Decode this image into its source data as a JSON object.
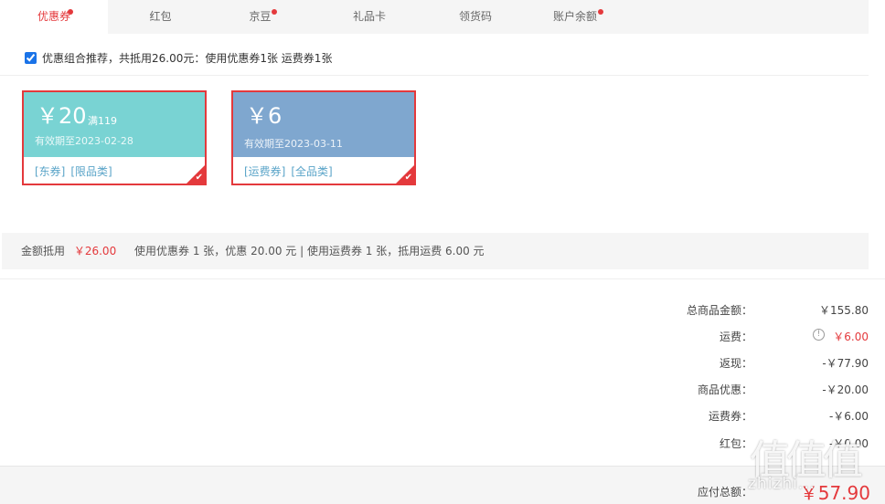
{
  "tabs": [
    {
      "label": "优惠券",
      "active": true,
      "dot": true
    },
    {
      "label": "红包",
      "active": false,
      "dot": false
    },
    {
      "label": "京豆",
      "active": false,
      "dot": true
    },
    {
      "label": "礼品卡",
      "active": false,
      "dot": false
    },
    {
      "label": "领货码",
      "active": false,
      "dot": false
    },
    {
      "label": "账户余额",
      "active": false,
      "dot": true
    }
  ],
  "recommend": {
    "checked": true,
    "label": "优惠组合推荐，共抵用26.00元：使用优惠券1张 运费券1张"
  },
  "coupons": [
    {
      "amount": "￥20",
      "condition": "满119",
      "expire": "有效期至2023-02-28",
      "tags": [
        "[东券]",
        "[限品类]"
      ],
      "color": "#79d3d3",
      "selected": true
    },
    {
      "amount": "￥6",
      "condition": "",
      "expire": "有效期至2023-03-11",
      "tags": [
        "[运费券]",
        "[全品类]"
      ],
      "color": "#7fa7cf",
      "selected": true
    }
  ],
  "summary": {
    "label": "金额抵用",
    "amount": "￥26.00",
    "detail": "使用优惠券 1 张，优惠 20.00 元  | 使用运费券 1 张，抵用运费 6.00 元"
  },
  "price_list": {
    "goods_label": "总商品金额：",
    "goods_value": "￥155.80",
    "freight_label": "运费：",
    "freight_value": "￥6.00",
    "cashback_label": "返现：",
    "cashback_value": "-￥77.90",
    "discount_label": "商品优惠：",
    "discount_value": "-￥20.00",
    "freight_coupon_label": "运费券：",
    "freight_coupon_value": "-￥6.00",
    "redpacket_label": "红包：",
    "redpacket_value": "-￥0.00"
  },
  "total": {
    "label": "应付总额：",
    "value": "￥57.90"
  },
  "watermark": {
    "logo": "值值值",
    "text": "zhizhi..."
  },
  "colors": {
    "accent": "#e4393c",
    "coupon1": "#79d3d3",
    "coupon2": "#7fa7cf",
    "tag": "#5aa4c8"
  }
}
